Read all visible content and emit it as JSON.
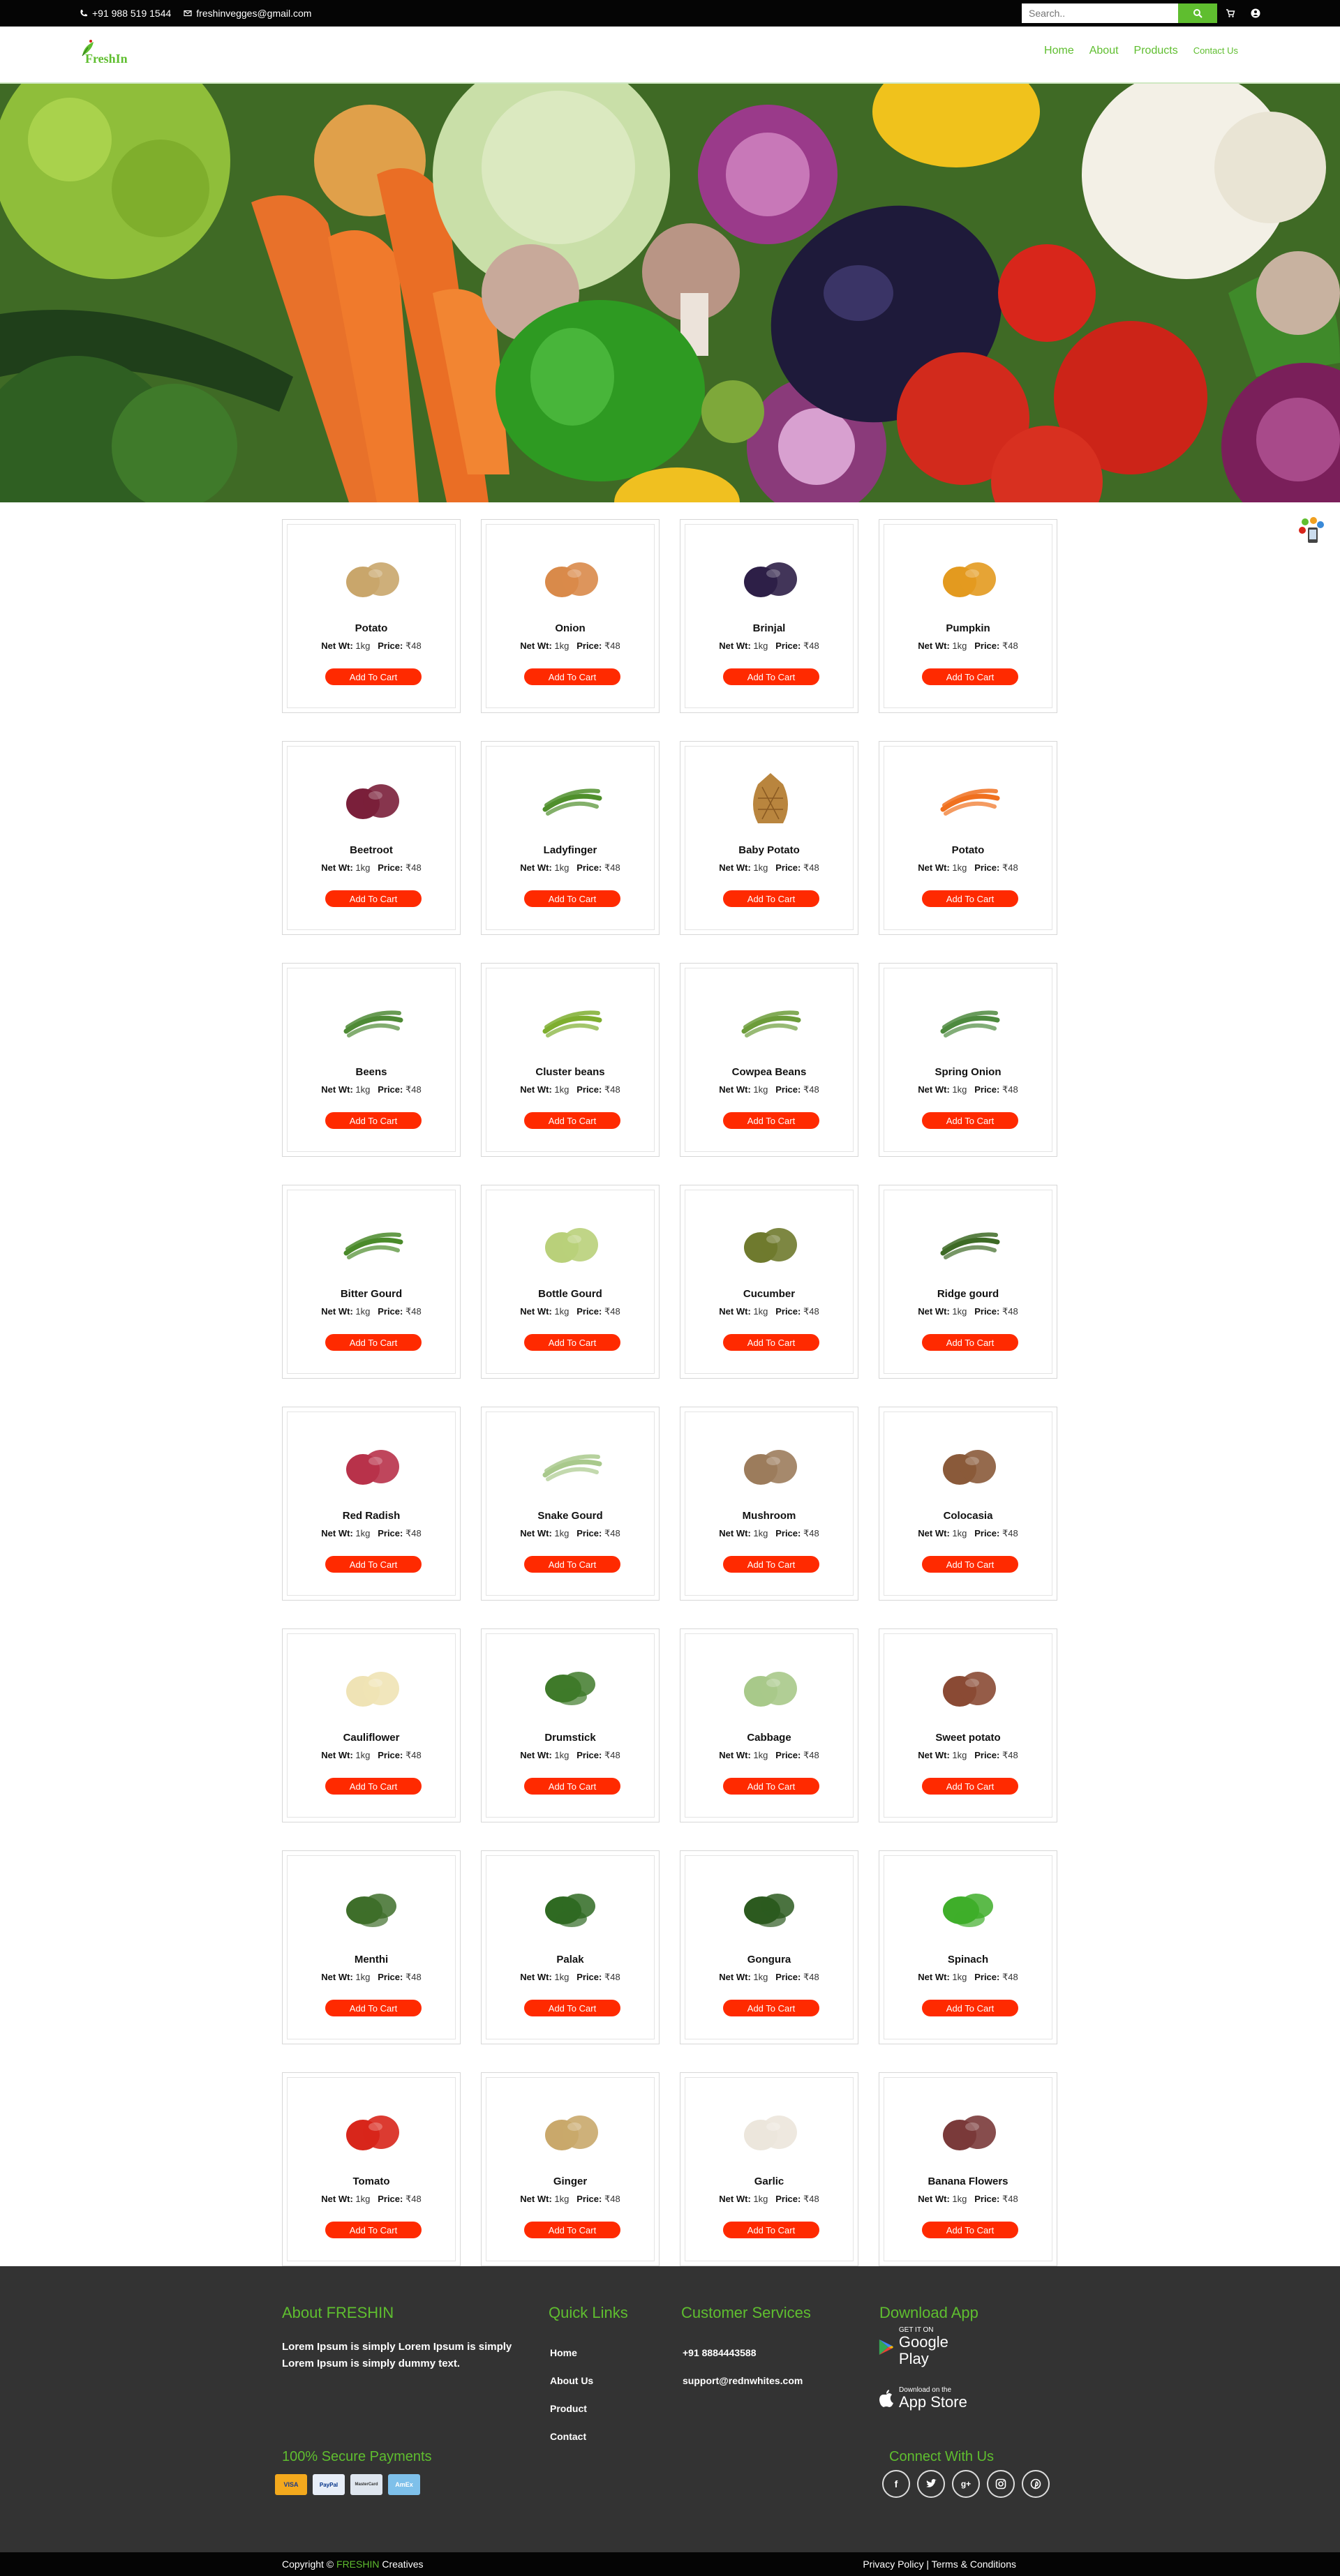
{
  "topbar": {
    "phone": "+91 988 519 1544",
    "email": "freshinvegges@gmail.com",
    "search_placeholder": "Search.."
  },
  "nav": {
    "logo_text": "FreshIn",
    "items": [
      "Home",
      "About",
      "Products",
      "Contact Us"
    ]
  },
  "product_common": {
    "net_label": "Net Wt:",
    "net_value": "1kg",
    "price_label": "Price:",
    "price_value": "₹48",
    "button_label": "Add To Cart"
  },
  "products": [
    {
      "name": "Potato",
      "icon": "potato",
      "color": "#c9a66b"
    },
    {
      "name": "Onion",
      "icon": "onion",
      "color": "#d98a4a"
    },
    {
      "name": "Brinjal",
      "icon": "brinjal",
      "color": "#2d1f47"
    },
    {
      "name": "Pumpkin",
      "icon": "pumpkin",
      "color": "#e39a1f"
    },
    {
      "name": "Beetroot",
      "icon": "beetroot",
      "color": "#7a1f3a"
    },
    {
      "name": "Ladyfinger",
      "icon": "ladyfinger",
      "color": "#4f8f2b"
    },
    {
      "name": "Baby Potato",
      "icon": "baby-potato",
      "color": "#b9853e"
    },
    {
      "name": "Potato",
      "icon": "carrot",
      "color": "#f0701e"
    },
    {
      "name": "Beens",
      "icon": "beans",
      "color": "#4e8a35"
    },
    {
      "name": "Cluster beans",
      "icon": "cluster-beans",
      "color": "#7eae2f"
    },
    {
      "name": "Cowpea Beans",
      "icon": "cowpea-beans",
      "color": "#6c9c3a"
    },
    {
      "name": "Spring Onion",
      "icon": "spring-onion",
      "color": "#4d8a3e"
    },
    {
      "name": "Bitter Gourd",
      "icon": "bitter-gourd",
      "color": "#4a8a2a"
    },
    {
      "name": "Bottle Gourd",
      "icon": "bottle-gourd",
      "color": "#b9d07a"
    },
    {
      "name": "Cucumber",
      "icon": "cucumber",
      "color": "#6f7a2e"
    },
    {
      "name": "Ridge gourd",
      "icon": "ridge-gourd",
      "color": "#3d6a25"
    },
    {
      "name": "Red Radish",
      "icon": "radish",
      "color": "#b8324a"
    },
    {
      "name": "Snake Gourd",
      "icon": "snake-gourd",
      "color": "#a9c98c"
    },
    {
      "name": "Mushroom",
      "icon": "mushroom",
      "color": "#9c7c5c"
    },
    {
      "name": "Colocasia",
      "icon": "colocasia",
      "color": "#8a5a3a"
    },
    {
      "name": "Cauliflower",
      "icon": "cauliflower",
      "color": "#efe3b5"
    },
    {
      "name": "Drumstick",
      "icon": "drumstick",
      "color": "#3f7a2a"
    },
    {
      "name": "Cabbage",
      "icon": "cabbage",
      "color": "#a8c98a"
    },
    {
      "name": "Sweet potato",
      "icon": "sweet-potato",
      "color": "#8a4a34"
    },
    {
      "name": "Menthi",
      "icon": "menthi",
      "color": "#3e6e2a"
    },
    {
      "name": "Palak",
      "icon": "palak",
      "color": "#2f6a22"
    },
    {
      "name": "Gongura",
      "icon": "gongura",
      "color": "#2c5a1f"
    },
    {
      "name": "Spinach",
      "icon": "spinach",
      "color": "#3fae2a"
    },
    {
      "name": "Tomato",
      "icon": "tomato",
      "color": "#d8261b"
    },
    {
      "name": "Ginger",
      "icon": "ginger",
      "color": "#c9a86b"
    },
    {
      "name": "Garlic",
      "icon": "garlic",
      "color": "#ece6dc"
    },
    {
      "name": "Banana Flowers",
      "icon": "banana-flower",
      "color": "#7a3a3a"
    }
  ],
  "footer": {
    "about_title": "About FRESHIN",
    "about_text": "Lorem Ipsum is simply Lorem Ipsum is simply Lorem Ipsum is simply dummy text.",
    "links_title": "Quick Links",
    "links": [
      "Home",
      "About Us",
      "Product",
      "Contact"
    ],
    "cs_title": "Customer Services",
    "cs_phone": "+91 8884443588",
    "cs_email": "support@rednwhites.com",
    "app_title": "Download App",
    "google_small": "GET IT ON",
    "google_big": "Google Play",
    "apple_small": "Download on the",
    "apple_big": "App Store",
    "payments_title": "100% Secure Payments",
    "payments": [
      "VISA",
      "PayPal",
      "MasterCard",
      "AmEx"
    ],
    "connect_title": "Connect With Us",
    "social": [
      "facebook-icon",
      "twitter-icon",
      "google-plus-icon",
      "instagram-icon",
      "pinterest-icon"
    ]
  },
  "bottom": {
    "copy_prefix": "Copyright ©",
    "copy_brand": "FRESHIN",
    "copy_suffix": "Creatives",
    "policy": "Privacy Policy | Terms & Conditions"
  }
}
